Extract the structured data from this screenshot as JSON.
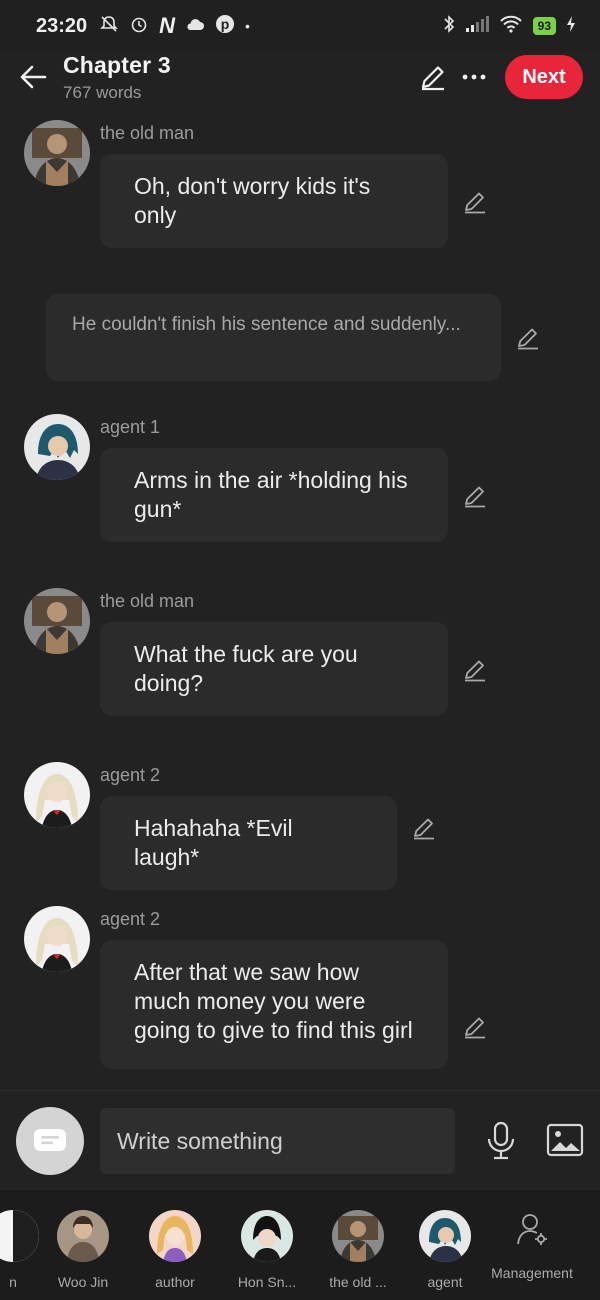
{
  "status_bar": {
    "time": "23:20",
    "battery": "93",
    "left_icons": [
      "mute-bell-icon",
      "alarm-icon",
      "netflix-icon",
      "cloud-icon",
      "pinterest-icon",
      "dot-icon"
    ],
    "right_icons": [
      "bluetooth-icon",
      "signal-icon",
      "wifi-icon",
      "battery-icon",
      "charging-icon"
    ]
  },
  "header": {
    "title": "Chapter 3",
    "subtitle": "767 words",
    "next_label": "Next"
  },
  "messages": [
    {
      "type": "dialogue",
      "speaker": "the old man",
      "text": "Oh, don't worry kids it's only"
    },
    {
      "type": "narration",
      "text": "He couldn't finish his sentence and suddenly..."
    },
    {
      "type": "dialogue",
      "speaker": "agent 1",
      "text": "Arms in the air *holding his gun*"
    },
    {
      "type": "dialogue",
      "speaker": "the old man",
      "text": "What the fuck are you doing?"
    },
    {
      "type": "dialogue",
      "speaker": "agent 2",
      "text": "Hahahaha *Evil laugh*"
    },
    {
      "type": "dialogue",
      "speaker": "agent 2",
      "text": "After that we saw how much money you were going to give to find this girl"
    }
  ],
  "composer": {
    "placeholder": "Write something"
  },
  "characters": [
    {
      "name": "n"
    },
    {
      "name": "Woo Jin"
    },
    {
      "name": "author"
    },
    {
      "name": "Hon Sn..."
    },
    {
      "name": "the old ..."
    },
    {
      "name": "agent"
    }
  ],
  "management_label": "Management",
  "colors": {
    "background": "#222222",
    "bubble": "#2b2b2b",
    "accent": "#e8253a",
    "battery": "#7ccf4a"
  }
}
